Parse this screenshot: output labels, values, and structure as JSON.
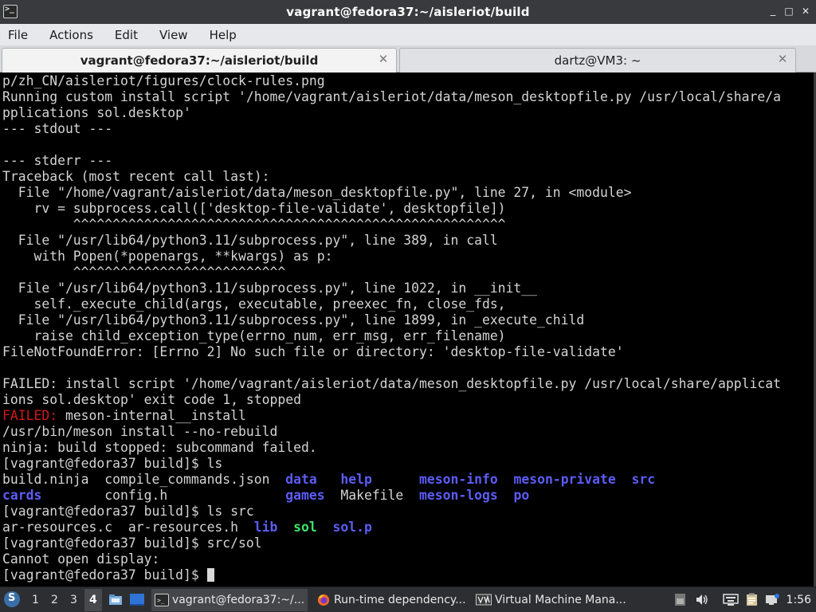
{
  "window": {
    "title": "vagrant@fedora37:~/aisleriot/build",
    "minimize": "_",
    "maximize": "□",
    "close": "✕"
  },
  "menubar": {
    "items": [
      "File",
      "Actions",
      "Edit",
      "View",
      "Help"
    ]
  },
  "tabs": [
    {
      "label": "vagrant@fedora37:~/aisleriot/build",
      "close": "✕",
      "active": true
    },
    {
      "label": "dartz@VM3: ~",
      "close": "✕",
      "active": false
    }
  ],
  "terminal": {
    "lines": [
      "p/zh_CN/aisleriot/figures/clock-rules.png",
      "Running custom install script '/home/vagrant/aisleriot/data/meson_desktopfile.py /usr/local/share/a",
      "pplications sol.desktop'",
      "--- stdout ---",
      "",
      "--- stderr ---",
      "Traceback (most recent call last):",
      "  File \"/home/vagrant/aisleriot/data/meson_desktopfile.py\", line 27, in <module>",
      "    rv = subprocess.call(['desktop-file-validate', desktopfile])",
      "         ^^^^^^^^^^^^^^^^^^^^^^^^^^^^^^^^^^^^^^^^^^^^^^^^^^^^^^^",
      "  File \"/usr/lib64/python3.11/subprocess.py\", line 389, in call",
      "    with Popen(*popenargs, **kwargs) as p:",
      "         ^^^^^^^^^^^^^^^^^^^^^^^^^^^",
      "  File \"/usr/lib64/python3.11/subprocess.py\", line 1022, in __init__",
      "    self._execute_child(args, executable, preexec_fn, close_fds,",
      "  File \"/usr/lib64/python3.11/subprocess.py\", line 1899, in _execute_child",
      "    raise child_exception_type(errno_num, err_msg, err_filename)",
      "FileNotFoundError: [Errno 2] No such file or directory: 'desktop-file-validate'",
      "",
      "FAILED: install script '/home/vagrant/aisleriot/data/meson_desktopfile.py /usr/local/share/applicat",
      "ions sol.desktop' exit code 1, stopped"
    ],
    "failed_label": "FAILED:",
    "failed_rest": " meson-internal__install",
    "lines2": [
      "/usr/bin/meson install --no-rebuild",
      "ninja: build stopped: subcommand failed.",
      "[vagrant@fedora37 build]$ ls"
    ],
    "ls_row1": {
      "plain": "build.ninja  compile_commands.json  ",
      "d1": "data",
      "s1": "   ",
      "d2": "help",
      "s2": "      ",
      "d3": "meson-info",
      "s3": "  ",
      "d4": "meson-private",
      "s4": "  ",
      "d5": "src"
    },
    "ls_row2": {
      "d1": "cards",
      "plain1": "        config.h               ",
      "d2": "games",
      "plain2": "  Makefile  ",
      "d3": "meson-logs",
      "s3": "  ",
      "d4": "po"
    },
    "prompt_ls_src": "[vagrant@fedora37 build]$ ls src",
    "ls_src": {
      "plain": "ar-resources.c  ar-resources.h  ",
      "d1": "lib",
      "s1": "  ",
      "exec": "sol",
      "s2": "  ",
      "d2": "sol.p"
    },
    "prompt_sol": "[vagrant@fedora37 build]$ src/sol",
    "cannot_open": "Cannot open display:",
    "prompt_final": "[vagrant@fedora37 build]$ "
  },
  "taskbar": {
    "workspaces": [
      "1",
      "2",
      "3",
      "4"
    ],
    "active_workspace": "4",
    "tasks": [
      {
        "label": "vagrant@fedora37:~/...",
        "icon": "terminal-icon",
        "active": true
      },
      {
        "label": "Run-time dependency...",
        "icon": "firefox-icon",
        "active": false
      },
      {
        "label": "Virtual Machine Mana...",
        "icon": "virt-manager-icon",
        "active": false
      }
    ],
    "clock": "1:56"
  }
}
